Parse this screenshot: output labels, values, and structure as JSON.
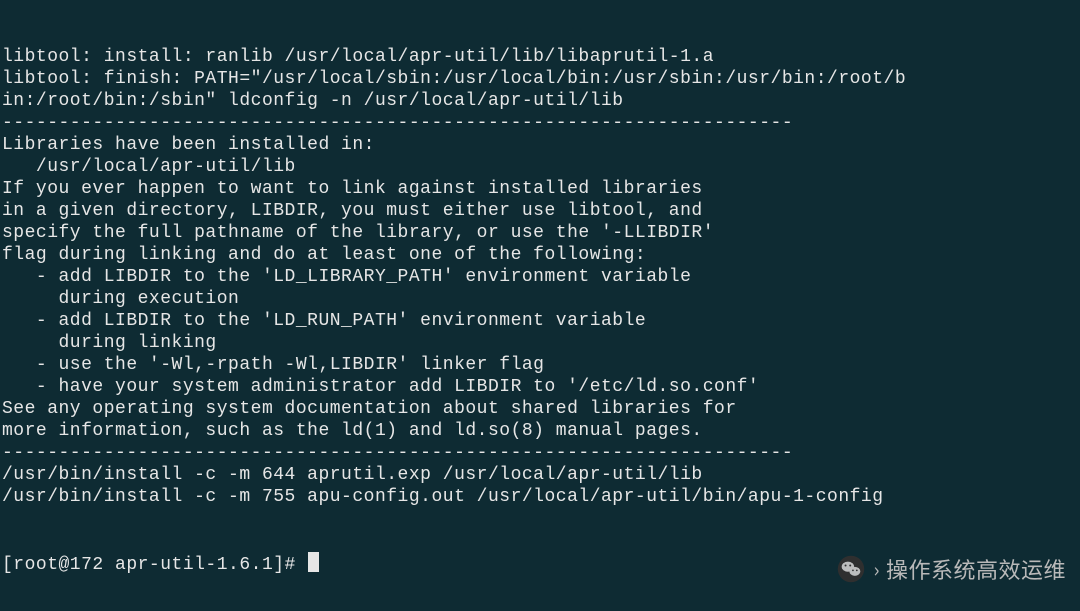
{
  "terminal": {
    "lines": [
      "libtool: install: ranlib /usr/local/apr-util/lib/libaprutil-1.a",
      "libtool: finish: PATH=\"/usr/local/sbin:/usr/local/bin:/usr/sbin:/usr/bin:/root/b",
      "in:/root/bin:/sbin\" ldconfig -n /usr/local/apr-util/lib",
      "----------------------------------------------------------------------",
      "Libraries have been installed in:",
      "   /usr/local/apr-util/lib",
      "",
      "If you ever happen to want to link against installed libraries",
      "in a given directory, LIBDIR, you must either use libtool, and",
      "specify the full pathname of the library, or use the '-LLIBDIR'",
      "flag during linking and do at least one of the following:",
      "   - add LIBDIR to the 'LD_LIBRARY_PATH' environment variable",
      "     during execution",
      "   - add LIBDIR to the 'LD_RUN_PATH' environment variable",
      "     during linking",
      "   - use the '-Wl,-rpath -Wl,LIBDIR' linker flag",
      "   - have your system administrator add LIBDIR to '/etc/ld.so.conf'",
      "",
      "See any operating system documentation about shared libraries for",
      "more information, such as the ld(1) and ld.so(8) manual pages.",
      "----------------------------------------------------------------------",
      "/usr/bin/install -c -m 644 aprutil.exp /usr/local/apr-util/lib",
      "/usr/bin/install -c -m 755 apu-config.out /usr/local/apr-util/bin/apu-1-config"
    ],
    "prompt": "[root@172 apr-util-1.6.1]# "
  },
  "watermark": {
    "text": "操作系统高效运维"
  }
}
